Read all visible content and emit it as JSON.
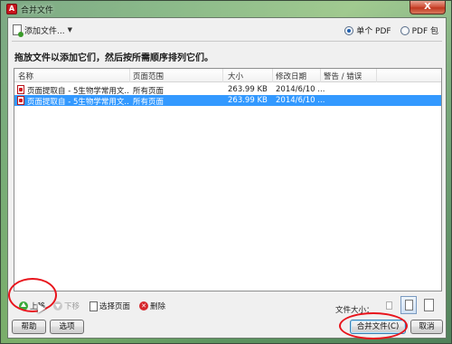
{
  "window": {
    "title": "合并文件",
    "app_icon": "pdf-app-icon",
    "close_label": "X"
  },
  "toolbar": {
    "add_files_label": "添加文件...",
    "radio_single_pdf": "单个 PDF",
    "radio_pdf_package": "PDF 包",
    "selected_option": "单个 PDF"
  },
  "instruction": "拖放文件以添加它们，然后按所需顺序排列它们。",
  "table": {
    "columns": [
      "名称",
      "页面范围",
      "大小",
      "修改日期",
      "警告 / 错误"
    ],
    "rows": [
      {
        "name": "页面提取自 - 5生物学常用文...",
        "range": "所有页面",
        "size": "263.99 KB",
        "date": "2014/6/10 ...",
        "warning": "",
        "selected": false
      },
      {
        "name": "页面提取自 - 5生物学常用文...",
        "range": "所有页面",
        "size": "263.99 KB",
        "date": "2014/6/10 ...",
        "warning": "",
        "selected": true
      }
    ]
  },
  "controls": {
    "move_up": "上移",
    "move_down": "下移",
    "choose_pages": "选择页面",
    "delete": "删除",
    "file_size_label": "文件大小："
  },
  "footer": {
    "help": "帮助",
    "options": "选项",
    "merge": "合并文件(C)",
    "cancel": "取消"
  },
  "colors": {
    "selection": "#3399ff",
    "annotation": "#e8141c",
    "window_bg": "#f0f0f0"
  }
}
